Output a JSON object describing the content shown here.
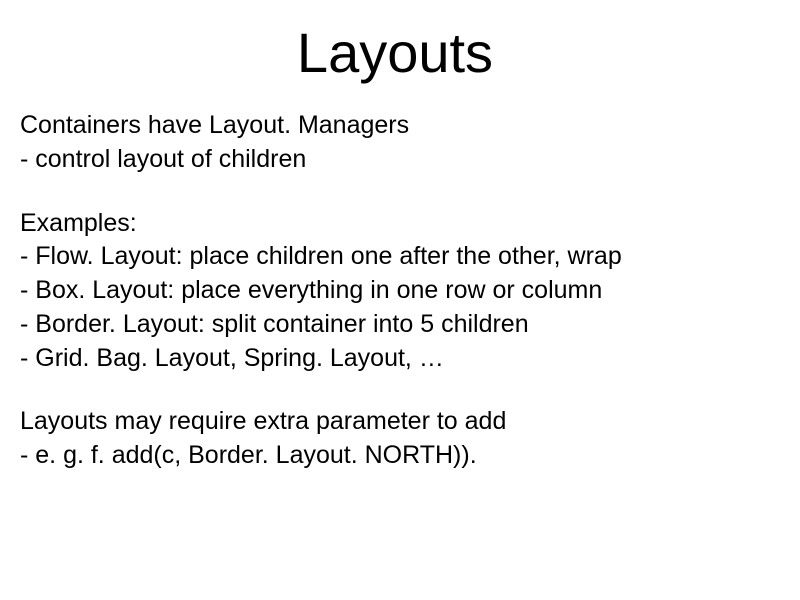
{
  "slide": {
    "title": "Layouts",
    "section1": {
      "line1": "Containers have Layout. Managers",
      "line2": " - control layout of children"
    },
    "section2": {
      "line1": "Examples:",
      "line2": " - Flow. Layout: place children one after the other, wrap",
      "line3": " - Box. Layout: place everything in one row or column",
      "line4": " - Border. Layout: split container into 5 children",
      "line5": " - Grid. Bag. Layout, Spring. Layout, …"
    },
    "section3": {
      "line1": "Layouts may require extra parameter to add",
      "line2": " - e. g. f. add(c, Border. Layout. NORTH))."
    }
  }
}
